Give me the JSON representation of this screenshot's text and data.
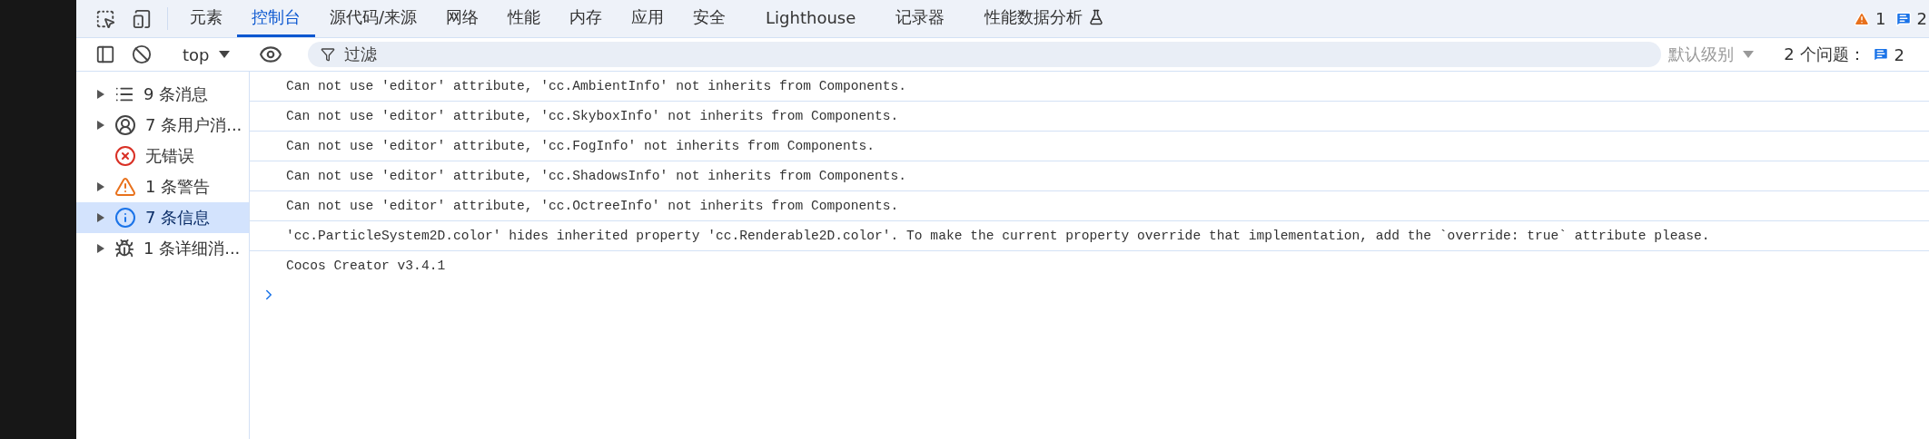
{
  "tabs": [
    {
      "label": "元素",
      "selected": false
    },
    {
      "label": "控制台",
      "selected": true
    },
    {
      "label": "源代码/来源",
      "selected": false
    },
    {
      "label": "网络",
      "selected": false
    },
    {
      "label": "性能",
      "selected": false
    },
    {
      "label": "内存",
      "selected": false
    },
    {
      "label": "应用",
      "selected": false
    },
    {
      "label": "安全",
      "selected": false
    },
    {
      "label": "Lighthouse",
      "selected": false
    },
    {
      "label": "记录器",
      "selected": false
    },
    {
      "label": "性能数据分析",
      "selected": false
    }
  ],
  "top_counts": {
    "warnings": "1",
    "messages": "2"
  },
  "toolbar": {
    "context": "top",
    "filter": {
      "placeholder": "过滤"
    },
    "level": "默认级别",
    "issues_label": "2 个问题：",
    "issues_count": "2"
  },
  "sidebar": {
    "items": [
      {
        "kind": "all",
        "label": "9 条消息",
        "expandable": true,
        "selected": false
      },
      {
        "kind": "user",
        "label": "7 条用户消...",
        "expandable": true,
        "selected": false
      },
      {
        "kind": "error",
        "label": "无错误",
        "expandable": false,
        "selected": false
      },
      {
        "kind": "warning",
        "label": "1 条警告",
        "expandable": true,
        "selected": false
      },
      {
        "kind": "info",
        "label": "7 条信息",
        "expandable": true,
        "selected": true
      },
      {
        "kind": "verbose",
        "label": "1 条详细消...",
        "expandable": true,
        "selected": false
      }
    ]
  },
  "messages": [
    "Can not use 'editor' attribute, 'cc.AmbientInfo' not inherits from Components.",
    "Can not use 'editor' attribute, 'cc.SkyboxInfo' not inherits from Components.",
    "Can not use 'editor' attribute, 'cc.FogInfo' not inherits from Components.",
    "Can not use 'editor' attribute, 'cc.ShadowsInfo' not inherits from Components.",
    "Can not use 'editor' attribute, 'cc.OctreeInfo' not inherits from Components.",
    "'cc.ParticleSystem2D.color' hides inherited property 'cc.Renderable2D.color'. To make the current property override that implementation, add the `override: true` attribute please.",
    "Cocos Creator v3.4.1"
  ]
}
